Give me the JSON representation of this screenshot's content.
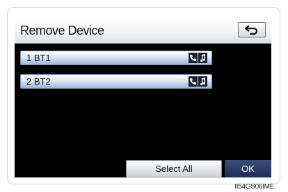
{
  "header": {
    "title": "Remove Device",
    "back_icon": "back-arrow-icon"
  },
  "devices": [
    {
      "label": "1  BT1",
      "icons": [
        "phone-icon",
        "music-note-icon"
      ]
    },
    {
      "label": "2  BT2",
      "icons": [
        "phone-icon",
        "music-note-icon"
      ]
    }
  ],
  "footer": {
    "select_all_label": "Select All",
    "ok_label": "OK"
  },
  "image_code": "II54GS06IME",
  "colors": {
    "row_gradient_bottom": "#9fb6d6",
    "ok_background": "#1f2d55",
    "screen_background": "#000000"
  }
}
